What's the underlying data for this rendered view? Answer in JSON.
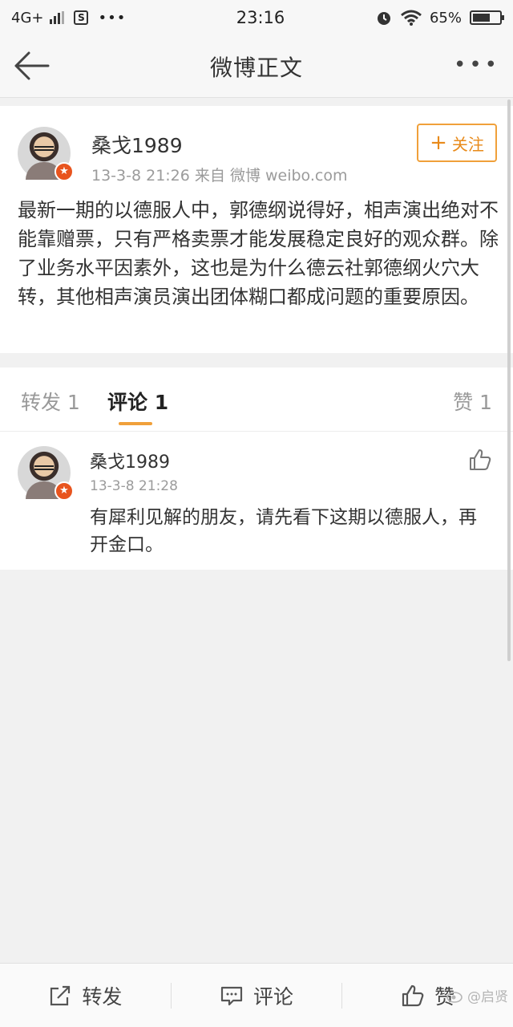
{
  "status_bar": {
    "network": "4G+",
    "notification_badge": "S",
    "more_dots": "•••",
    "time": "23:16",
    "battery_text": "65%",
    "battery_level": 0.65
  },
  "nav": {
    "title": "微博正文",
    "more": "•••"
  },
  "post": {
    "author": "桑戈1989",
    "meta": "13-3-8 21:26  来自 微博 weibo.com",
    "follow_label": "关注",
    "content": "最新一期的以德服人中，郭德纲说得好，相声演出绝对不能靠赠票，只有严格卖票才能发展稳定良好的观众群。除了业务水平因素外，这也是为什么德云社郭德纲火穴大转，其他相声演员演出团体糊口都成问题的重要原因。"
  },
  "tabs": {
    "repost": "转发 1",
    "comment": "评论 1",
    "like": "赞 1"
  },
  "comments": [
    {
      "author": "桑戈1989",
      "time": "13-3-8 21:28",
      "text": "有犀利见解的朋友，请先看下这期以德服人，再开金口。"
    }
  ],
  "bottom_bar": {
    "repost": "转发",
    "comment": "评论",
    "like": "赞"
  },
  "watermark": "@启贤",
  "colors": {
    "accent": "#f0a03a",
    "badge": "#e8541e"
  }
}
